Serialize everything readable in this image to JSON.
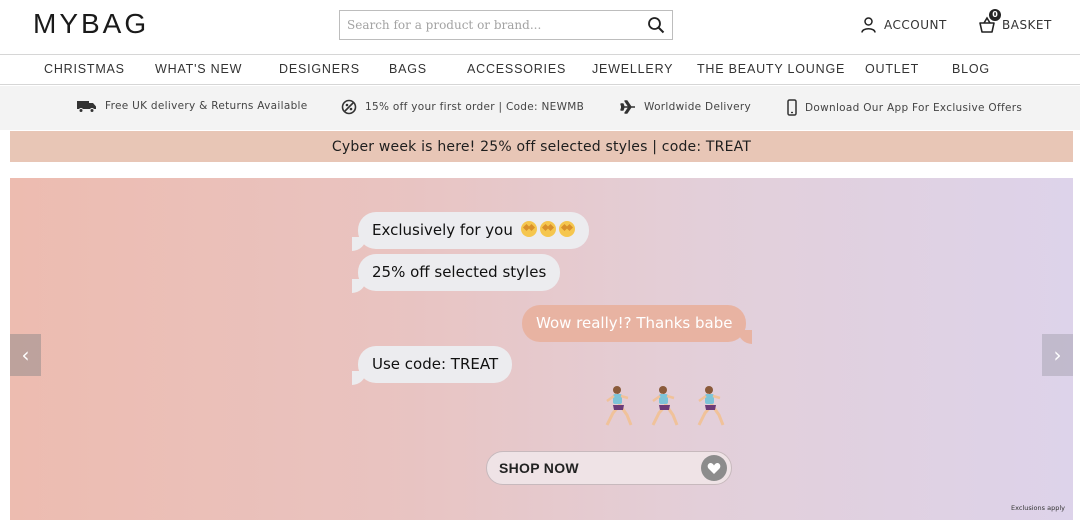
{
  "header": {
    "logo": "MYBAG",
    "search_placeholder": "Search for a product or brand...",
    "account_label": "ACCOUNT",
    "basket_label": "BASKET",
    "basket_count": "0"
  },
  "nav": {
    "items": [
      "CHRISTMAS",
      "WHAT'S NEW",
      "DESIGNERS",
      "BAGS",
      "ACCESSORIES",
      "JEWELLERY",
      "THE BEAUTY LOUNGE",
      "OUTLET",
      "BLOG"
    ]
  },
  "usp": {
    "items": [
      {
        "icon": "delivery-truck-icon",
        "text": "Free UK delivery & Returns Available"
      },
      {
        "icon": "discount-tag-icon",
        "text": "15% off your first order | Code: NEWMB"
      },
      {
        "icon": "airplane-icon",
        "text": "Worldwide Delivery"
      },
      {
        "icon": "mobile-phone-icon",
        "text": "Download Our App For Exclusive Offers"
      }
    ]
  },
  "promo": {
    "text": "Cyber week is here! 25% off selected styles | code: TREAT",
    "background": "#e8c6b6"
  },
  "hero": {
    "messages": [
      {
        "side": "left",
        "text": "Exclusively for you"
      },
      {
        "side": "left",
        "text": "25% off selected styles"
      },
      {
        "side": "right",
        "text": "Wow really!? Thanks babe"
      },
      {
        "side": "left",
        "text": "Use code: TREAT"
      }
    ],
    "emoji_names": [
      "star-struck-emoji",
      "star-struck-emoji",
      "star-struck-emoji"
    ],
    "runner_icons": [
      "running-woman-icon",
      "running-woman-icon",
      "running-woman-icon"
    ],
    "shop_now_label": "SHOP NOW",
    "prev_arrow": "‹",
    "next_arrow": "›",
    "exclusions_text": "Exclusions apply",
    "colors": {
      "gradient_start": "#edbcb0",
      "gradient_end": "#ddd3ea",
      "reply_bubble": "#e8b3a2"
    }
  }
}
